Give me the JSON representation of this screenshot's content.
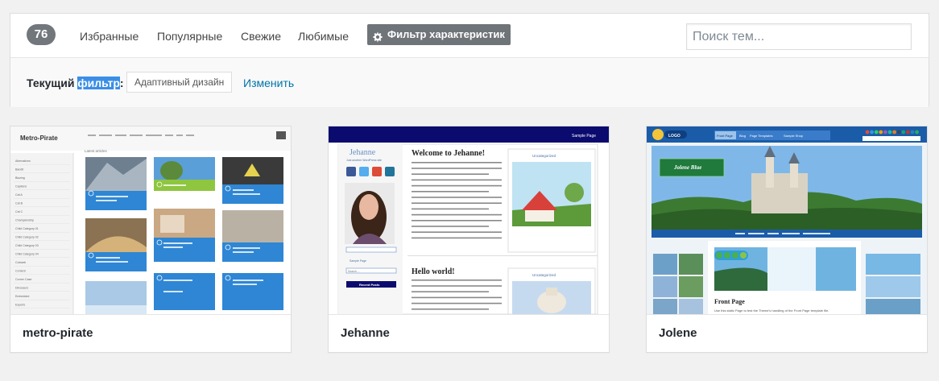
{
  "filter_bar": {
    "count": "76",
    "tabs": [
      {
        "label": "Избранные"
      },
      {
        "label": "Популярные"
      },
      {
        "label": "Свежие"
      },
      {
        "label": "Любимые"
      }
    ],
    "feature_filter_label": "Фильтр характеристик",
    "search_placeholder": "Поиск тем...",
    "current_filter_prefix": "Текущий ",
    "current_filter_highlight": "фильтр",
    "current_filter_suffix": ":",
    "active_filter_tag": "Адаптивный дизайн",
    "edit_link": "Изменить"
  },
  "themes": [
    {
      "name": "metro-pirate",
      "preview": {
        "logo": "Metro-Pirate",
        "heading": "Latest articles",
        "sidebar_items": [
          "Alternatives",
          "Bandit",
          "Blazing",
          "Captions",
          "Cat A",
          "Cat B",
          "Cat C",
          "Championship",
          "Child Category 01",
          "Child Category 02",
          "Child Category 03",
          "Child Category 04",
          "Cobweb",
          "Content",
          "Corner Case",
          "Dinosaurs",
          "Embedded",
          "Experts"
        ]
      }
    },
    {
      "name": "Jehanne",
      "preview": {
        "site_title": "Jehanne",
        "tagline": "Just another WordPress site",
        "sample_page": "Sample Page",
        "post1_title": "Welcome to Jehanne!",
        "post2_title": "Hello world!",
        "category": "Uncategorized",
        "search_label": "Search ...",
        "recent_posts": "Recent Posts"
      }
    },
    {
      "name": "Jolene",
      "preview": {
        "logo": "LOGO",
        "nav_items": [
          "Front Page",
          "Blog",
          "Page Templates",
          "Sample Shop"
        ],
        "banner_title": "Jolene Blue",
        "page_title": "Front Page",
        "page_text": "Use this static Page to test the Theme's handling of the Front Page template file."
      }
    }
  ]
}
